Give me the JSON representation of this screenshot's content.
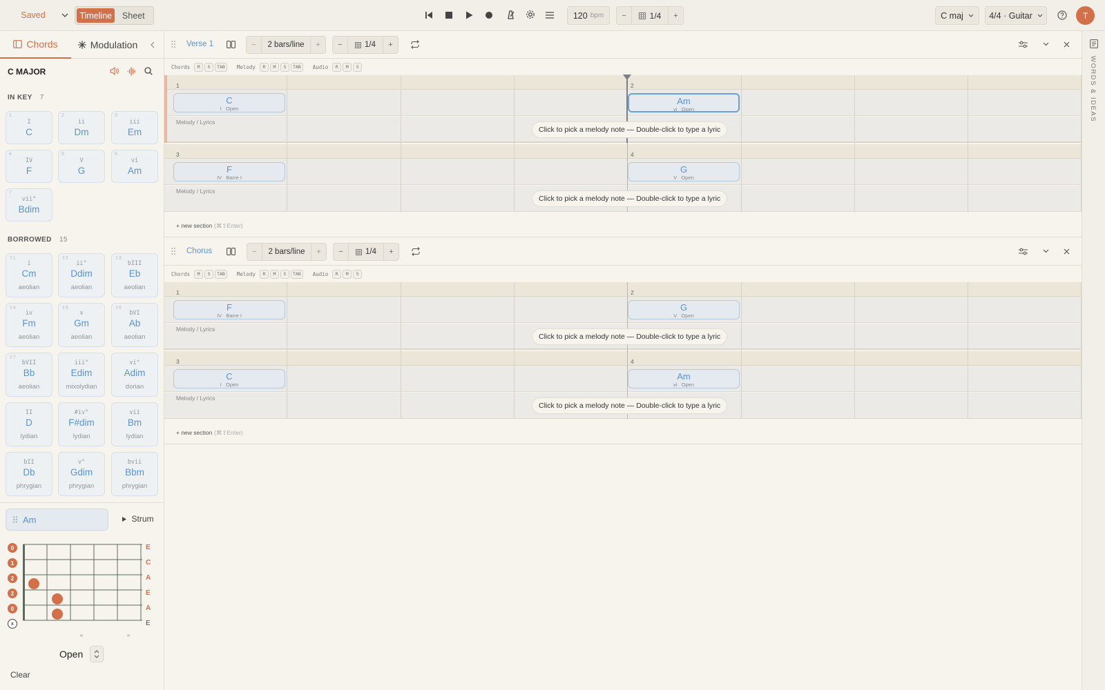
{
  "topbar": {
    "saved": "Saved",
    "view_tabs": [
      "Timeline",
      "Sheet"
    ],
    "tempo": "120",
    "tempo_unit": "bpm",
    "grid": "1/4",
    "grid_minus": "−",
    "grid_plus": "+",
    "key": "C maj",
    "meter": "4/4 · Guitar",
    "avatar": "T"
  },
  "sidebar": {
    "tabs": [
      "Chords",
      "Modulation"
    ],
    "key_title": "C MAJOR",
    "in_key_label": "IN KEY",
    "in_key_count": "7",
    "in_key": [
      {
        "num": "1",
        "roman": "I",
        "name": "C"
      },
      {
        "num": "2",
        "roman": "ii",
        "name": "Dm"
      },
      {
        "num": "3",
        "roman": "iii",
        "name": "Em"
      },
      {
        "num": "4",
        "roman": "IV",
        "name": "F"
      },
      {
        "num": "5",
        "roman": "V",
        "name": "G"
      },
      {
        "num": "6",
        "roman": "vi",
        "name": "Am"
      },
      {
        "num": "7",
        "roman": "vii°",
        "name": "Bdim"
      }
    ],
    "borrowed_label": "BORROWED",
    "borrowed_count": "15",
    "borrowed": [
      {
        "num": "⇧1",
        "roman": "i",
        "name": "Cm",
        "mode": "aeolian"
      },
      {
        "num": "⇧2",
        "roman": "ii°",
        "name": "Ddim",
        "mode": "aeolian"
      },
      {
        "num": "⇧3",
        "roman": "bIII",
        "name": "Eb",
        "mode": "aeolian"
      },
      {
        "num": "⇧4",
        "roman": "iv",
        "name": "Fm",
        "mode": "aeolian"
      },
      {
        "num": "⇧5",
        "roman": "v",
        "name": "Gm",
        "mode": "aeolian"
      },
      {
        "num": "⇧6",
        "roman": "bVI",
        "name": "Ab",
        "mode": "aeolian"
      },
      {
        "num": "⇧7",
        "roman": "bVII",
        "name": "Bb",
        "mode": "aeolian"
      },
      {
        "num": "",
        "roman": "iii°",
        "name": "Edim",
        "mode": "mixolydian"
      },
      {
        "num": "",
        "roman": "vi°",
        "name": "Adim",
        "mode": "dorian"
      },
      {
        "num": "",
        "roman": "II",
        "name": "D",
        "mode": "lydian"
      },
      {
        "num": "",
        "roman": "#iv°",
        "name": "F#dim",
        "mode": "lydian"
      },
      {
        "num": "",
        "roman": "vii",
        "name": "Bm",
        "mode": "lydian"
      },
      {
        "num": "",
        "roman": "bII",
        "name": "Db",
        "mode": "phrygian"
      },
      {
        "num": "",
        "roman": "v°",
        "name": "Gdim",
        "mode": "phrygian"
      },
      {
        "num": "",
        "roman": "bvii",
        "name": "Bbm",
        "mode": "phrygian"
      }
    ],
    "selected_chord": "Am",
    "strum": "Strum",
    "fret_numbers": [
      "0",
      "1",
      "2",
      "2",
      "0",
      "x"
    ],
    "string_names": [
      "E",
      "C",
      "A",
      "E",
      "A",
      "E"
    ],
    "voicing": "Open",
    "clear": "Clear"
  },
  "sections": [
    {
      "name": "Verse 1",
      "bars_per_line": "2 bars/line",
      "grid": "1/4",
      "tracks": [
        "Chords",
        "Melody",
        "Audio"
      ],
      "chord_btns": [
        "M",
        "S",
        "TAB"
      ],
      "melody_btns": [
        "R",
        "M",
        "S",
        "TAB"
      ],
      "audio_btns": [
        "R",
        "M",
        "S"
      ],
      "melody_label": "Melody / Lyrics",
      "hint": "Click to pick a melody note — Double-click to type a lyric",
      "bars": [
        {
          "n": "1",
          "chord": "C",
          "roman": "I",
          "voicing": "Open"
        },
        {
          "n": "2",
          "chord": "Am",
          "roman": "vi",
          "voicing": "Open"
        },
        {
          "n": "3",
          "chord": "F",
          "roman": "IV",
          "voicing": "Barre I"
        },
        {
          "n": "4",
          "chord": "G",
          "roman": "V",
          "voicing": "Open"
        }
      ],
      "new_section": "+ new section",
      "new_section_hint": "(⌘⇧Enter)"
    },
    {
      "name": "Chorus",
      "bars_per_line": "2 bars/line",
      "grid": "1/4",
      "tracks": [
        "Chords",
        "Melody",
        "Audio"
      ],
      "chord_btns": [
        "M",
        "S",
        "TAB"
      ],
      "melody_btns": [
        "R",
        "M",
        "S",
        "TAB"
      ],
      "audio_btns": [
        "R",
        "M",
        "S"
      ],
      "melody_label": "Melody / Lyrics",
      "hint": "Click to pick a melody note — Double-click to type a lyric",
      "bars": [
        {
          "n": "1",
          "chord": "F",
          "roman": "IV",
          "voicing": "Barre I"
        },
        {
          "n": "2",
          "chord": "G",
          "roman": "V",
          "voicing": "Open"
        },
        {
          "n": "3",
          "chord": "C",
          "roman": "I",
          "voicing": "Open"
        },
        {
          "n": "4",
          "chord": "Am",
          "roman": "vi",
          "voicing": "Open"
        }
      ],
      "new_section": "+ new section",
      "new_section_hint": "(⌘⇧Enter)"
    }
  ],
  "right_panel": {
    "label": "WORDS & IDEAS"
  },
  "colors": {
    "accent": "#d2704a",
    "chord_blue": "#5b93cc",
    "bg": "#f7f4ee"
  },
  "icons": [
    "chevron-down-icon",
    "skip-back-icon",
    "stop-icon",
    "play-icon",
    "record-icon",
    "metronome-icon",
    "gear-icon",
    "menu-icon",
    "grid-icon",
    "help-icon",
    "chord-icon",
    "sparkle-icon",
    "chevron-left-icon",
    "speaker-icon",
    "waveform-icon",
    "search-icon",
    "drag-handle-icon",
    "columns-icon",
    "loop-icon",
    "settings-sliders-icon",
    "close-icon",
    "notes-icon",
    "play-triangle-icon",
    "chevron-updown-icon"
  ]
}
